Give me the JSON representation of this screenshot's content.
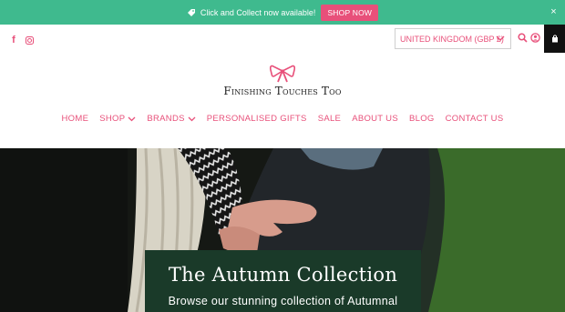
{
  "announcement": {
    "text": "Click and Collect now available!",
    "button_label": "SHOP NOW",
    "close_symbol": "×",
    "icon": "tag-icon"
  },
  "social": {
    "facebook_symbol": "f",
    "icons": [
      "facebook-icon",
      "instagram-icon"
    ]
  },
  "currency": {
    "selected": "UNITED KINGDOM (GBP £)"
  },
  "utility_icons": [
    "search-icon",
    "account-icon",
    "cart-icon"
  ],
  "logo": {
    "text": "Finishing Touches Too",
    "icon": "bow-icon"
  },
  "nav": {
    "items": [
      {
        "label": "HOME"
      },
      {
        "label": "SHOP"
      },
      {
        "label": "BRANDS"
      },
      {
        "label": "PERSONALISED GIFTS"
      },
      {
        "label": "SALE"
      },
      {
        "label": "ABOUT US"
      },
      {
        "label": "BLOG"
      },
      {
        "label": "CONTACT US"
      }
    ]
  },
  "hero": {
    "title": "The Autumn Collection",
    "subtitle": "Browse our stunning collection of Autumnal"
  },
  "colors": {
    "announcement_bg": "#3fba8e",
    "accent_pink": "#e8507a",
    "hero_green_box": "#1a3a29",
    "hero_right_bg": "#3a6b2a"
  }
}
